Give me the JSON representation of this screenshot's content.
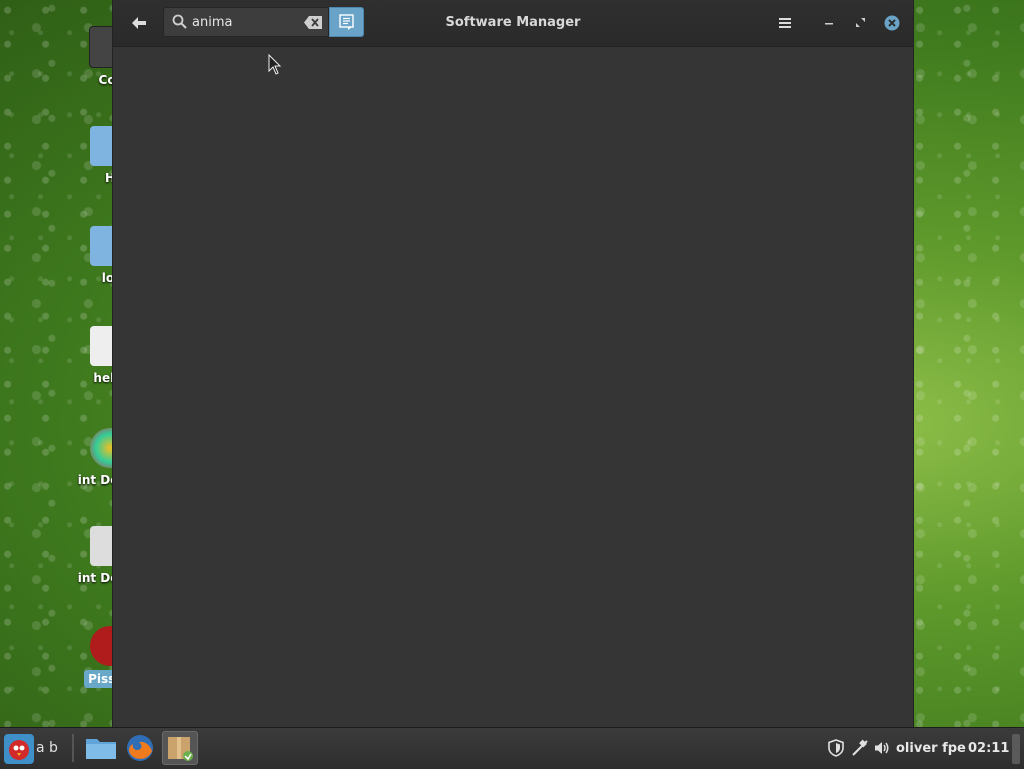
{
  "desktop": {
    "icons": [
      {
        "label": "Cor",
        "selected": false
      },
      {
        "label": "H",
        "selected": false
      },
      {
        "label": "lol",
        "selected": false
      },
      {
        "label": "hello",
        "selected": false
      },
      {
        "label": "int Downl",
        "selected": false
      },
      {
        "label": "int Downl",
        "selected": false
      },
      {
        "label": "Pissan",
        "selected": true
      }
    ]
  },
  "window": {
    "title": "Software Manager",
    "search": {
      "value": "anima",
      "placeholder": ""
    },
    "controls": {
      "menu": "menu-icon",
      "minimize": "minimize-icon",
      "maximize": "maximize-icon",
      "close": "close-icon"
    }
  },
  "taskbar": {
    "menu_label": "a b",
    "tasks": [
      {
        "name": "files",
        "active": false
      },
      {
        "name": "firefox",
        "active": false
      },
      {
        "name": "software-manager",
        "active": true
      }
    ],
    "user_label": "oliver fpe",
    "clock": "02:11"
  },
  "colors": {
    "window_bg": "#353535",
    "titlebar": "#2c2c2c",
    "accent": "#6aa3c8",
    "close_button": "#6aa3c8",
    "taskbar": "#333333"
  }
}
